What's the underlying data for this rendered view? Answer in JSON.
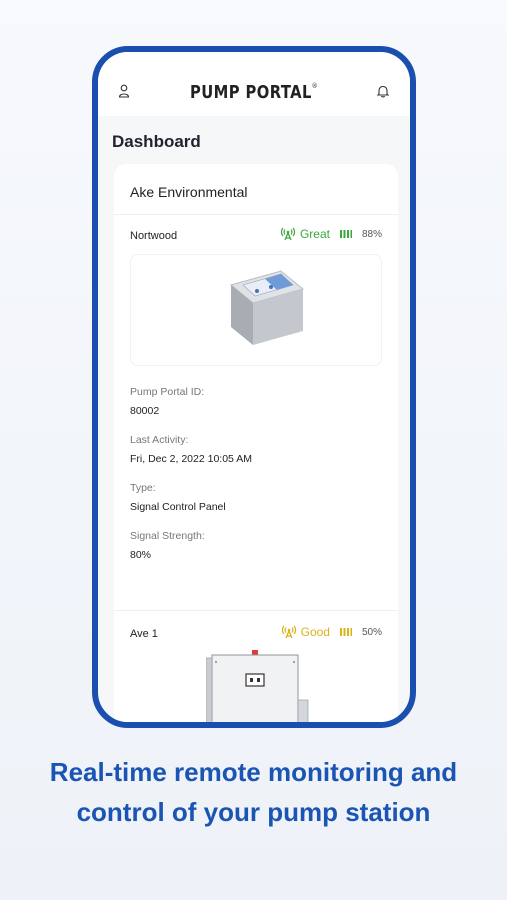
{
  "header": {
    "brand": "PUMP PORTAL",
    "brand_mark": "®"
  },
  "dashboard": {
    "title": "Dashboard"
  },
  "account": {
    "name": "Ake Environmental"
  },
  "stations": [
    {
      "name": "Nortwood",
      "status": "Great",
      "status_color": "#3aa83a",
      "battery": "88%",
      "fields": [
        {
          "label": "Pump Portal ID:",
          "value": "80002"
        },
        {
          "label": "Last Activity:",
          "value": "Fri, Dec 2, 2022 10:05 AM"
        },
        {
          "label": "Type:",
          "value": "Signal Control Panel"
        },
        {
          "label": "Signal Strength:",
          "value": "80%"
        }
      ]
    },
    {
      "name": "Ave 1",
      "status": "Good",
      "status_color": "#d9b21a",
      "battery": "50%"
    }
  ],
  "tagline": "Real-time remote monitoring and control of your pump station"
}
